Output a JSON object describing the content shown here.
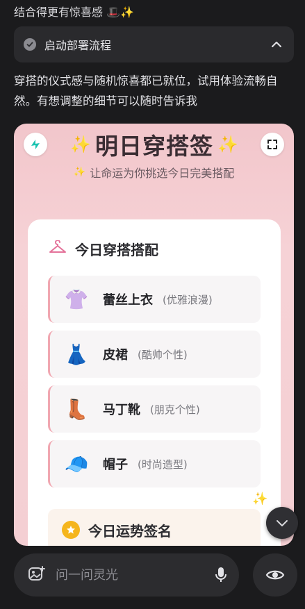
{
  "top_line": "结合得更有惊喜感 🎩✨",
  "deploy_bar": {
    "label": "启动部署流程",
    "icon": "chevron-up-icon"
  },
  "message": "穿搭的仪式感与随机惊喜都已就位，试用体验流畅自然。有想调整的细节可以随时告诉我",
  "card": {
    "title": "明日穿搭签",
    "subtitle": "让命运为你挑选今日完美搭配",
    "outfit_heading": "今日穿搭搭配",
    "items": [
      {
        "icon": "👚",
        "name": "蕾丝上衣",
        "style": "(优雅浪漫)"
      },
      {
        "icon": "👗",
        "name": "皮裙",
        "style": "(酷帅个性)"
      },
      {
        "icon": "👢",
        "name": "马丁靴",
        "style": "(朋克个性)"
      },
      {
        "icon": "🧢",
        "name": "帽子",
        "style": "(时尚造型)"
      }
    ],
    "fortune_heading": "今日运势签名"
  },
  "input": {
    "placeholder": "问一问灵光"
  },
  "colors": {
    "accent_pink": "#f0a7b1",
    "card_bg": "#f4cfd3",
    "star": "#f5b51c"
  }
}
